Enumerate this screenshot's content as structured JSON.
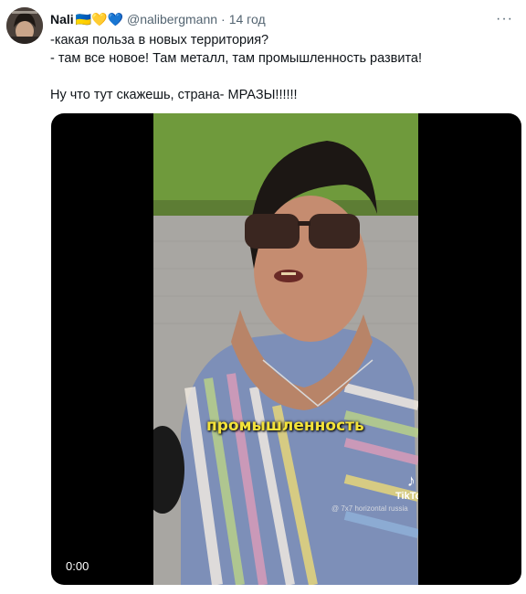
{
  "user": {
    "display_name": "Nali",
    "name_emojis": "🇺🇦💛💙",
    "handle": "@nalibergmann",
    "separator": "·",
    "time": "14 год"
  },
  "tweet": {
    "text": "-какая польза в новых территория?\n- там все новое! Там металл, там промышленность развита!\n\nНу что тут скажешь,  страна- МРАЗЫ!!!!!!"
  },
  "video": {
    "caption": "промышленность",
    "tiktok_label": "TikTok",
    "watermark": "@ 7x7 horizontal russia",
    "timecode": "0:00"
  },
  "colors": {
    "text": "#0f1419",
    "muted": "#536471",
    "caption": "#f3e23a"
  }
}
